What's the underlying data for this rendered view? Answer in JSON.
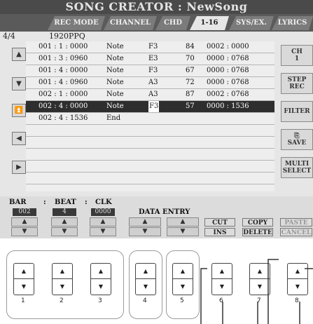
{
  "title": "SONG CREATOR : NewSong",
  "tabs": [
    "REC MODE",
    "CHANNEL",
    "CHD",
    "1-16",
    "SYS/EX.",
    "LYRICS"
  ],
  "active_tab": "1-16",
  "page_indicator": "4/4",
  "resolution": "1920PPQ",
  "events": [
    {
      "pos": "001 : 1 : 0000",
      "type": "Note",
      "note": "F3",
      "vel": "84",
      "len": "0002 : 0000"
    },
    {
      "pos": "001 : 3 : 0960",
      "type": "Note",
      "note": "E3",
      "vel": "70",
      "len": "0000 : 0768"
    },
    {
      "pos": "001 : 4 : 0000",
      "type": "Note",
      "note": "F3",
      "vel": "67",
      "len": "0000 : 0768"
    },
    {
      "pos": "001 : 4 : 0960",
      "type": "Note",
      "note": "A3",
      "vel": "72",
      "len": "0000 : 0768"
    },
    {
      "pos": "002 : 1 : 0000",
      "type": "Note",
      "note": "A3",
      "vel": "87",
      "len": "0002 : 0768"
    },
    {
      "pos": "002 : 4 : 0000",
      "type": "Note",
      "note": "F3",
      "vel": "57",
      "len": "0000 : 1536"
    },
    {
      "pos": "002 : 4 : 1536",
      "type": "End",
      "note": "",
      "vel": "",
      "len": ""
    }
  ],
  "selected_row": 5,
  "right_buttons": [
    {
      "line1": "CH",
      "line2": "1"
    },
    {
      "line1": "STEP",
      "line2": "REC"
    },
    {
      "line1": "FILTER",
      "line2": ""
    },
    {
      "line1": "⎘",
      "line2": "SAVE"
    },
    {
      "line1": "MULTI",
      "line2": "SELECT"
    }
  ],
  "bar_label": "BAR",
  "beat_label": "BEAT",
  "clk_label": "CLK",
  "sep1": ":",
  "sep2": ":",
  "bar_value": "002",
  "beat_value": "4",
  "clk_value": "0000",
  "data_entry_label": "DATA ENTRY",
  "cut": "CUT",
  "ins": "INS",
  "copy": "COPY",
  "delete": "DELETE",
  "paste": "PASTE",
  "cancel": "CANCEL",
  "button_numbers": [
    "1",
    "2",
    "3",
    "4",
    "5",
    "6",
    "7",
    "8"
  ],
  "up_glyph": "▲",
  "down_glyph": "▼"
}
